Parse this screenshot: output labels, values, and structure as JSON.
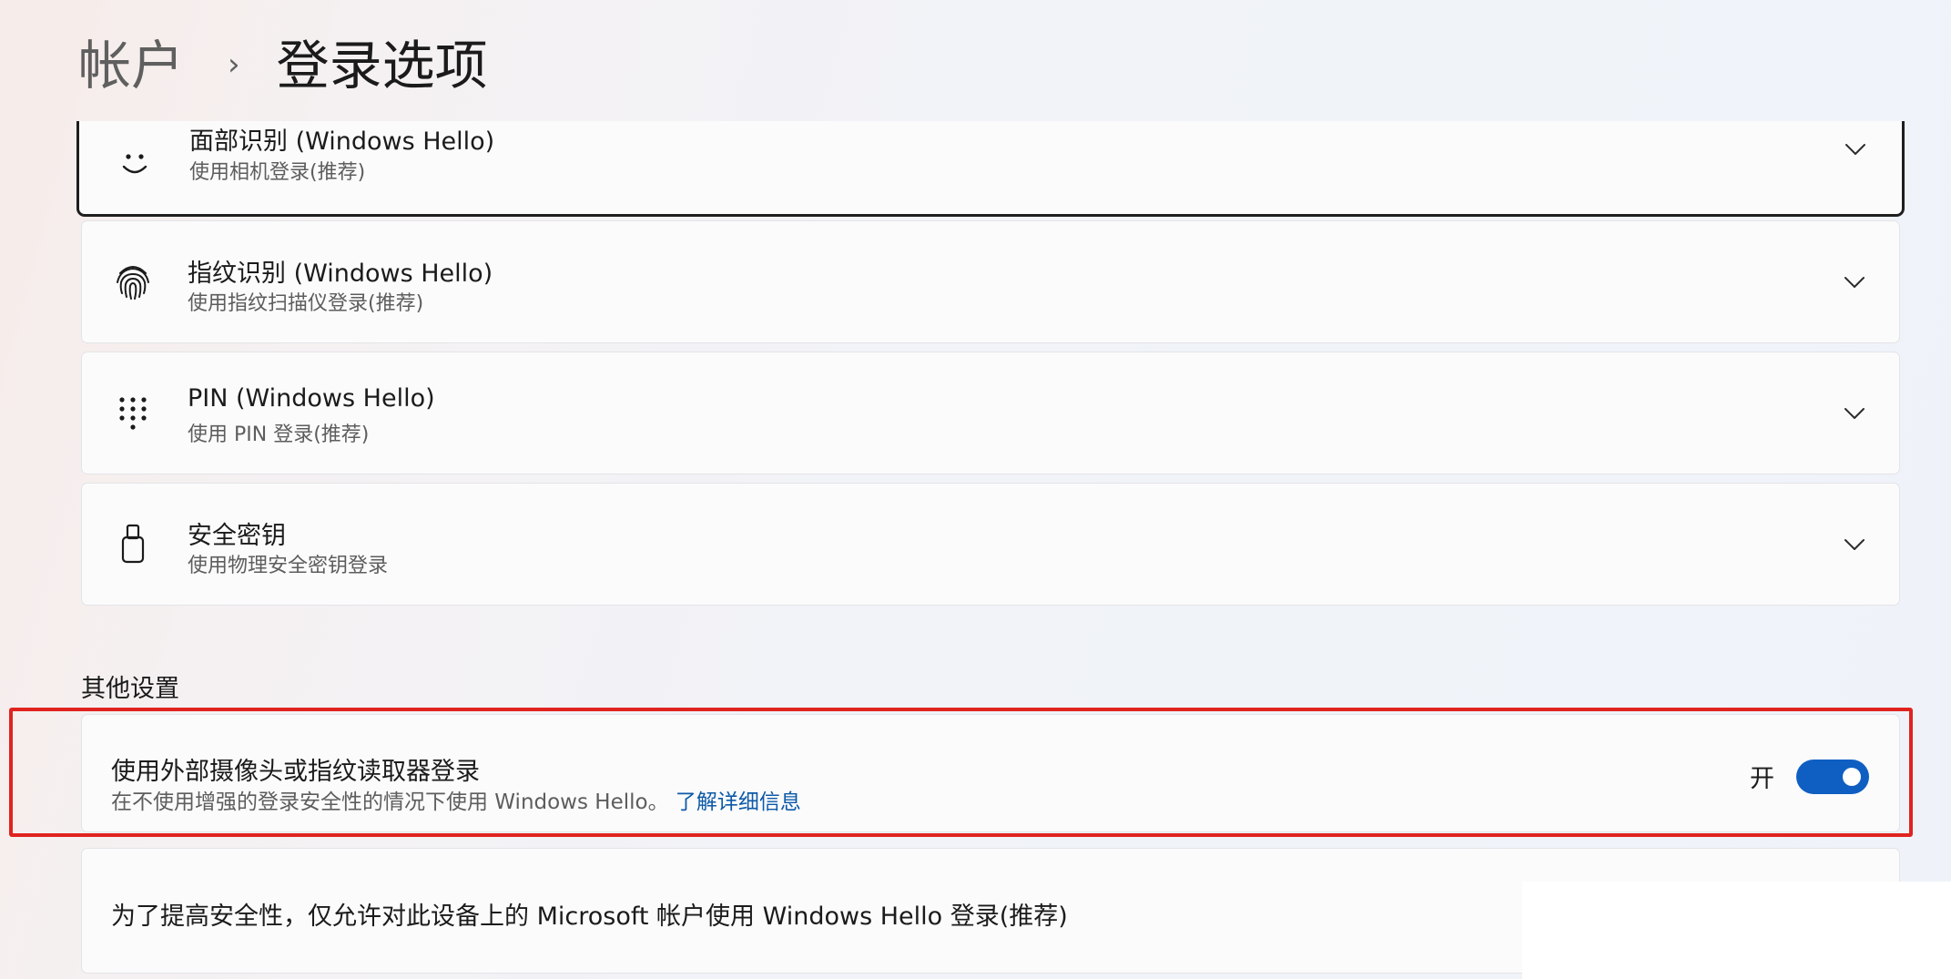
{
  "breadcrumb": {
    "parent": "帐户",
    "separator": "›",
    "current": "登录选项"
  },
  "sign_in_methods": [
    {
      "icon": "face-smile-icon",
      "title": "面部识别 (Windows Hello)",
      "subtitle": "使用相机登录(推荐)"
    },
    {
      "icon": "fingerprint-icon",
      "title": "指纹识别 (Windows Hello)",
      "subtitle": "使用指纹扫描仪登录(推荐)"
    },
    {
      "icon": "pin-keypad-icon",
      "title": "PIN (Windows Hello)",
      "subtitle": "使用 PIN 登录(推荐)"
    },
    {
      "icon": "usb-key-icon",
      "title": "安全密钥",
      "subtitle": "使用物理安全密钥登录"
    }
  ],
  "other_settings": {
    "section_title": "其他设置",
    "external_camera": {
      "title": "使用外部摄像头或指纹读取器登录",
      "description": "在不使用增强的登录安全性的情况下使用 Windows Hello。",
      "link": "了解详细信息",
      "toggle_state_label": "开",
      "toggle_on": true,
      "accent_color": "#0f5fc2"
    },
    "microsoft_only": {
      "title": "为了提高安全性，仅允许对此设备上的 Microsoft 帐户使用 Windows Hello 登录(推荐)"
    }
  },
  "highlight_color": "#e0231f"
}
